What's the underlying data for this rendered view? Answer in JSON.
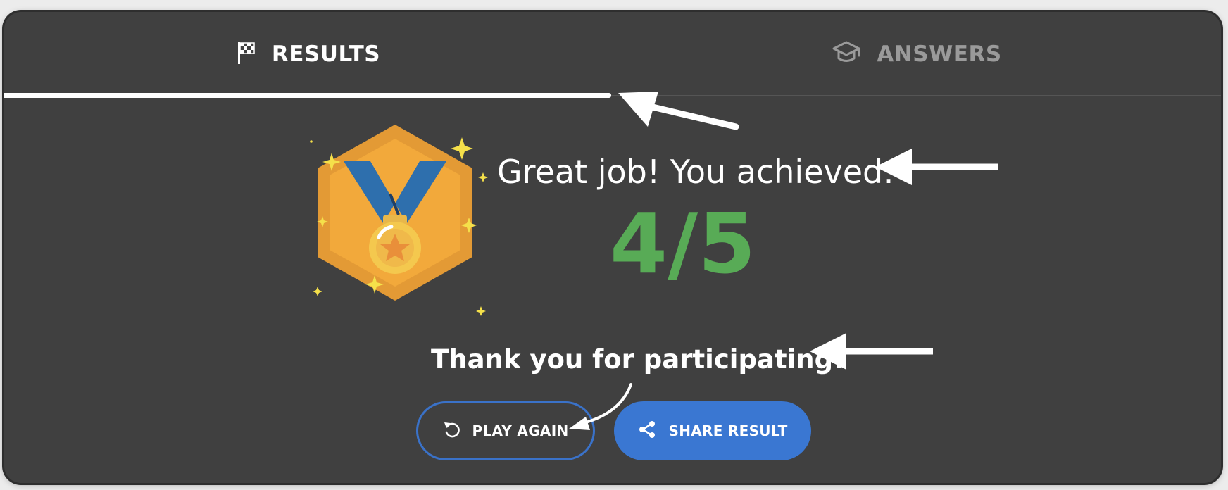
{
  "tabs": [
    {
      "label": "RESULTS",
      "icon": "checkered-flag-icon",
      "active": true
    },
    {
      "label": "ANSWERS",
      "icon": "graduation-cap-icon",
      "active": false
    }
  ],
  "result": {
    "headline": "Great job! You achieved:",
    "score": "4/5",
    "thanks": "Thank you for participating!"
  },
  "buttons": {
    "play_again": {
      "label": "PLAY AGAIN",
      "icon": "replay-icon"
    },
    "share_result": {
      "label": "SHARE RESULT",
      "icon": "share-icon"
    }
  },
  "colors": {
    "background": "#404040",
    "score": "#58ab56",
    "accent_blue": "#3a77d2",
    "medal_orange": "#f2a93b",
    "ribbon_blue": "#2e6fad"
  }
}
